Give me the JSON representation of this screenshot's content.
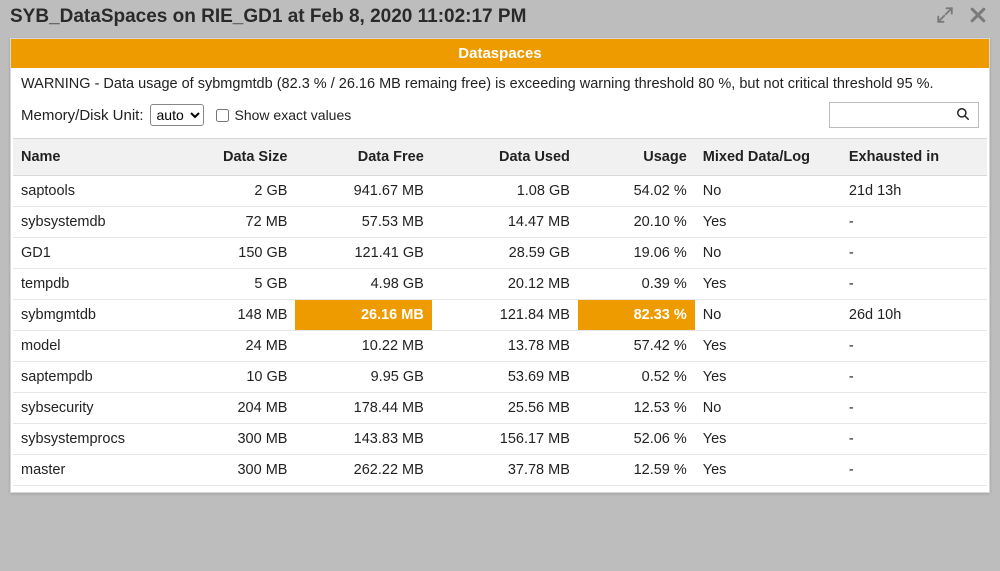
{
  "title": "SYB_DataSpaces on RIE_GD1 at Feb 8, 2020 11:02:17 PM",
  "banner": "Dataspaces",
  "warning": "WARNING - Data usage of sybmgmtdb (82.3 % / 26.16 MB remaing free) is exceeding warning threshold 80 %, but not critical threshold 95 %.",
  "controls": {
    "unit_label": "Memory/Disk Unit:",
    "unit_value": "auto",
    "exact_label": "Show exact values",
    "exact_checked": false,
    "search_value": ""
  },
  "columns": {
    "name": "Name",
    "data_size": "Data Size",
    "data_free": "Data Free",
    "data_used": "Data Used",
    "usage": "Usage",
    "mixed": "Mixed Data/Log",
    "exhausted": "Exhausted in"
  },
  "rows": [
    {
      "name": "saptools",
      "data_size": "2 GB",
      "data_free": "941.67 MB",
      "data_used": "1.08 GB",
      "usage": "54.02 %",
      "mixed": "No",
      "exhausted": "21d 13h",
      "hl_free": false,
      "hl_usage": false
    },
    {
      "name": "sybsystemdb",
      "data_size": "72 MB",
      "data_free": "57.53 MB",
      "data_used": "14.47 MB",
      "usage": "20.10 %",
      "mixed": "Yes",
      "exhausted": "-",
      "hl_free": false,
      "hl_usage": false
    },
    {
      "name": "GD1",
      "data_size": "150 GB",
      "data_free": "121.41 GB",
      "data_used": "28.59 GB",
      "usage": "19.06 %",
      "mixed": "No",
      "exhausted": "-",
      "hl_free": false,
      "hl_usage": false
    },
    {
      "name": "tempdb",
      "data_size": "5 GB",
      "data_free": "4.98 GB",
      "data_used": "20.12 MB",
      "usage": "0.39 %",
      "mixed": "Yes",
      "exhausted": "-",
      "hl_free": false,
      "hl_usage": false
    },
    {
      "name": "sybmgmtdb",
      "data_size": "148 MB",
      "data_free": "26.16 MB",
      "data_used": "121.84 MB",
      "usage": "82.33 %",
      "mixed": "No",
      "exhausted": "26d 10h",
      "hl_free": true,
      "hl_usage": true
    },
    {
      "name": "model",
      "data_size": "24 MB",
      "data_free": "10.22 MB",
      "data_used": "13.78 MB",
      "usage": "57.42 %",
      "mixed": "Yes",
      "exhausted": "-",
      "hl_free": false,
      "hl_usage": false
    },
    {
      "name": "saptempdb",
      "data_size": "10 GB",
      "data_free": "9.95 GB",
      "data_used": "53.69 MB",
      "usage": "0.52 %",
      "mixed": "Yes",
      "exhausted": "-",
      "hl_free": false,
      "hl_usage": false
    },
    {
      "name": "sybsecurity",
      "data_size": "204 MB",
      "data_free": "178.44 MB",
      "data_used": "25.56 MB",
      "usage": "12.53 %",
      "mixed": "No",
      "exhausted": "-",
      "hl_free": false,
      "hl_usage": false
    },
    {
      "name": "sybsystemprocs",
      "data_size": "300 MB",
      "data_free": "143.83 MB",
      "data_used": "156.17 MB",
      "usage": "52.06 %",
      "mixed": "Yes",
      "exhausted": "-",
      "hl_free": false,
      "hl_usage": false
    },
    {
      "name": "master",
      "data_size": "300 MB",
      "data_free": "262.22 MB",
      "data_used": "37.78 MB",
      "usage": "12.59 %",
      "mixed": "Yes",
      "exhausted": "-",
      "hl_free": false,
      "hl_usage": false
    }
  ]
}
